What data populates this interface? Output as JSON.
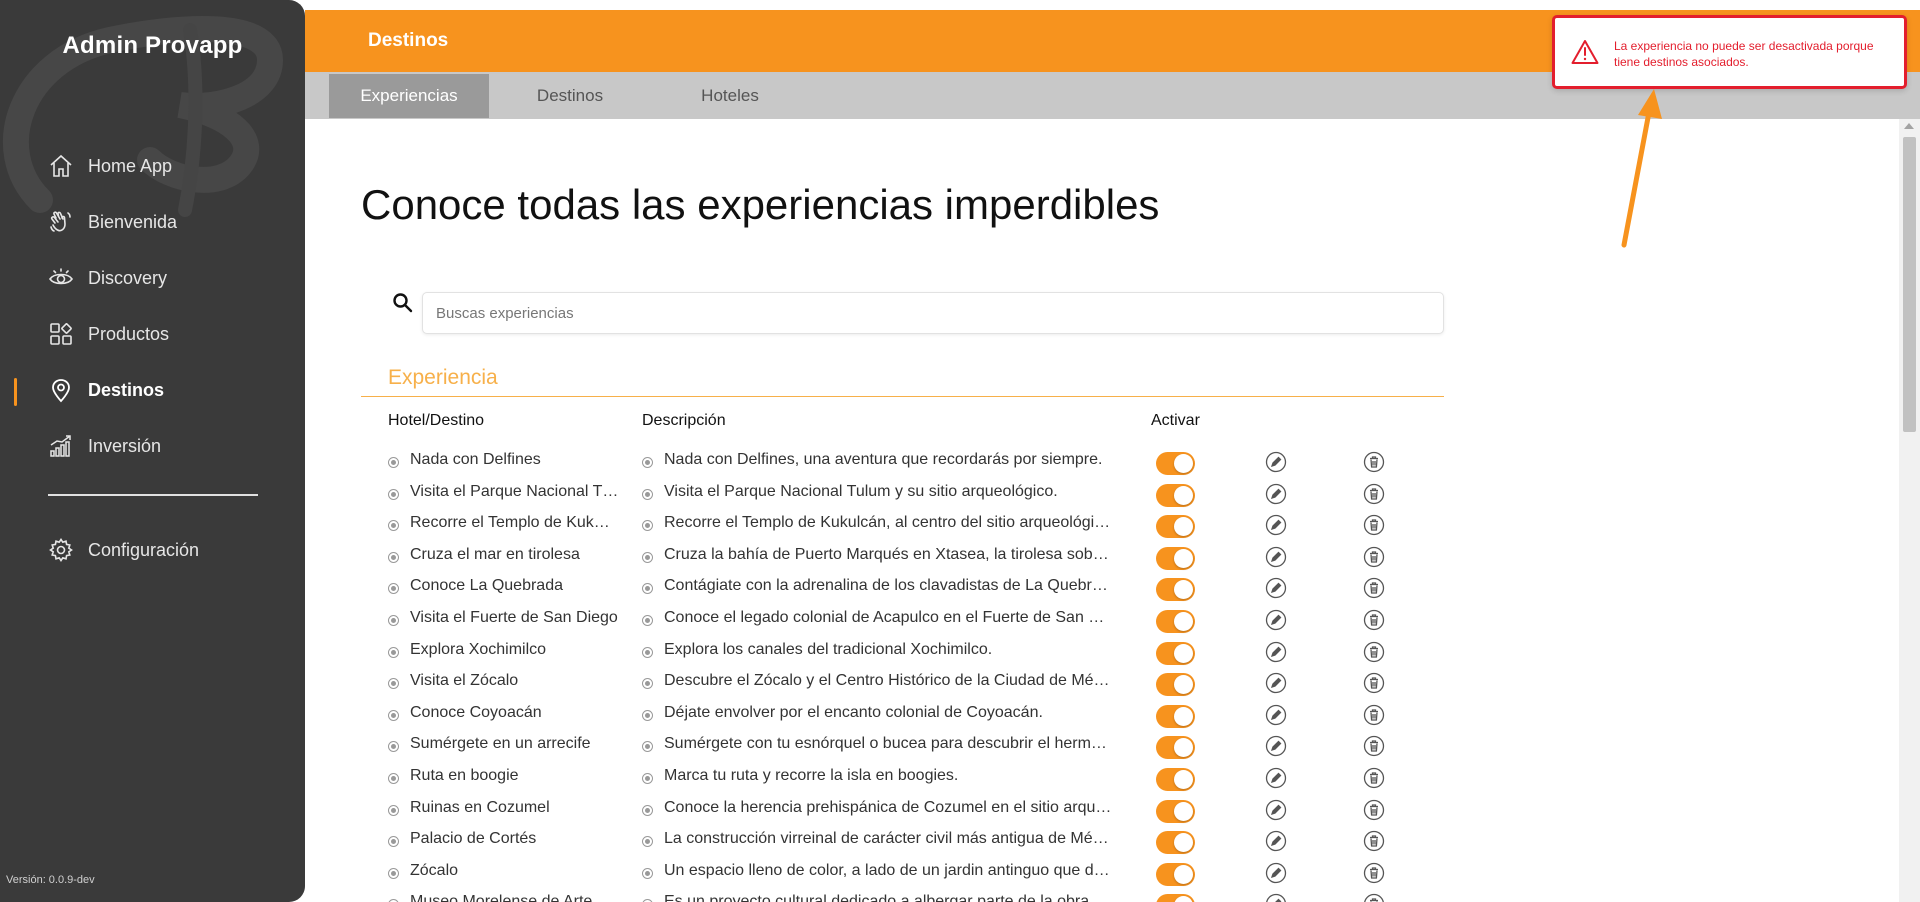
{
  "sidebar": {
    "brand": "Admin Provapp",
    "items": [
      {
        "label": "Home App",
        "icon": "home-icon"
      },
      {
        "label": "Bienvenida",
        "icon": "waving-hand-icon"
      },
      {
        "label": "Discovery",
        "icon": "eye-icon"
      },
      {
        "label": "Productos",
        "icon": "grid-shapes-icon"
      },
      {
        "label": "Destinos",
        "icon": "map-pin-icon",
        "active": true
      },
      {
        "label": "Inversión",
        "icon": "bar-chart-icon"
      }
    ],
    "settings_label": "Configuración",
    "version": "Versión: 0.0.9-dev"
  },
  "header": {
    "title": "Destinos",
    "tabs": [
      {
        "label": "Experiencias",
        "active": true
      },
      {
        "label": "Destinos"
      },
      {
        "label": "Hoteles"
      }
    ]
  },
  "main": {
    "page_title": "Conoce todas las experiencias imperdibles",
    "search_placeholder": "Buscas experiencias",
    "section_title": "Experiencia",
    "columns": {
      "name": "Hotel/Destino",
      "description": "Descripción",
      "activate": "Activar"
    },
    "rows": [
      {
        "name": "Nada con Delfines",
        "description": "Nada con Delfines, una aventura que recordarás por siempre.",
        "active": true
      },
      {
        "name": "Visita el Parque Nacional T…",
        "description": "Visita el Parque Nacional Tulum y su sitio arqueológico.",
        "active": true
      },
      {
        "name": "Recorre el Templo de Kuk…",
        "description": "Recorre el Templo de Kukulcán, al centro del sitio arqueológi…",
        "active": true
      },
      {
        "name": "Cruza el mar en tirolesa",
        "description": "Cruza la bahía de Puerto Marqués en Xtasea, la tirolesa sobr…",
        "active": true
      },
      {
        "name": "Conoce La Quebrada",
        "description": "Contágiate con la adrenalina de los clavadistas de La Quebr…",
        "active": true
      },
      {
        "name": "Visita el Fuerte de San Diego",
        "description": "Conoce el legado colonial de Acapulco en el Fuerte de San …",
        "active": true
      },
      {
        "name": "Explora Xochimilco",
        "description": "Explora los canales del tradicional Xochimilco.",
        "active": true
      },
      {
        "name": "Visita el Zócalo",
        "description": "Descubre el Zócalo y el Centro Histórico de la Ciudad de Mé…",
        "active": true
      },
      {
        "name": "Conoce Coyoacán",
        "description": "Déjate envolver por el encanto colonial de Coyoacán.",
        "active": true
      },
      {
        "name": "Sumérgete en un arrecife",
        "description": "Sumérgete con tu esnórquel o bucea para descubrir el herm…",
        "active": true
      },
      {
        "name": "Ruta en boogie",
        "description": "Marca tu ruta y recorre la isla en boogies.",
        "active": true
      },
      {
        "name": "Ruinas en Cozumel",
        "description": "Conoce la herencia prehispánica de Cozumel en el sitio arqu…",
        "active": true
      },
      {
        "name": "Palacio de Cortés",
        "description": "La construcción virreinal de carácter civil más antigua de Mé…",
        "active": true
      },
      {
        "name": "Zócalo",
        "description": "Un espacio lleno de color, a lado de un jardin antinguo que d…",
        "active": true
      },
      {
        "name": "Museo Morelense de Arte",
        "description": "Es un proyecto cultural dedicado a albergar parte de la obra…",
        "active": true
      }
    ]
  },
  "toast": {
    "message": "La experiencia no puede ser desactivada porque tiene destinos asociados."
  },
  "colors": {
    "accent": "#f7931e",
    "sidebar_bg": "#3a3a3a",
    "error": "#e31e2d",
    "section_title": "#f7b04a",
    "tab_bar": "#c8c8c8",
    "tab_active": "#9a9a9a"
  }
}
